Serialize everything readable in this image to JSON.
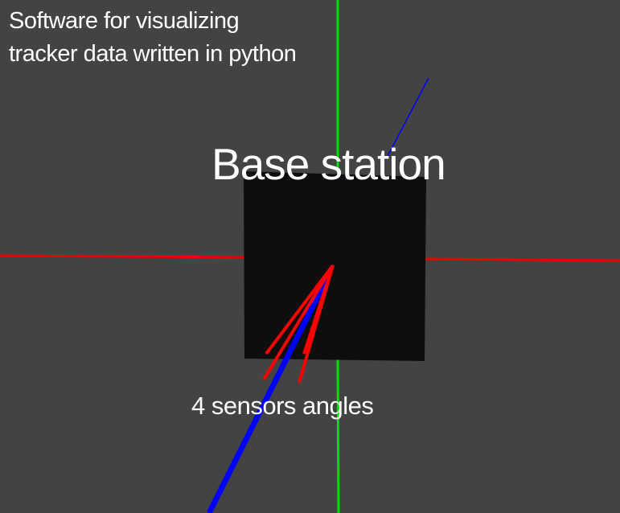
{
  "overlay": {
    "description_line1": "Software for visualizing",
    "description_line2": "tracker data written in python"
  },
  "scene": {
    "base_station_label": "Base station",
    "sensors_label": "4 sensors angles",
    "colors": {
      "background": "#434343",
      "base_station_box": "#0e0e0e",
      "x_axis": "#ee0000",
      "y_axis": "#00e000",
      "z_axis": "#0000ff",
      "sensor_rays": "#ff0000"
    }
  }
}
